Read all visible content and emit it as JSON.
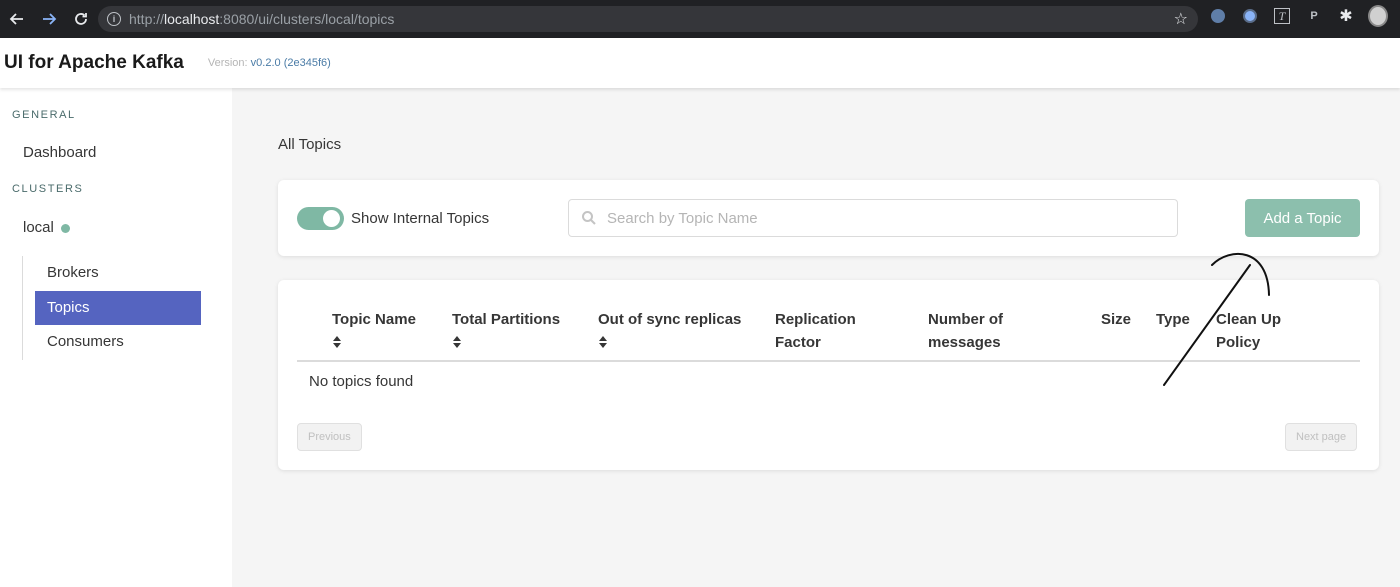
{
  "browser": {
    "url_prefix": "http://",
    "url_host": "localhost",
    "url_rest": ":8080/ui/clusters/local/topics",
    "ext_t": "T",
    "ext_p": "P"
  },
  "header": {
    "title": "UI for Apache Kafka",
    "version_label": "Version:",
    "version_value": "v0.2.0",
    "version_hash": "(2e345f6)"
  },
  "sidebar": {
    "general_label": "GENERAL",
    "dashboard": "Dashboard",
    "clusters_label": "CLUSTERS",
    "cluster_name": "local",
    "items": [
      {
        "label": "Brokers"
      },
      {
        "label": "Topics"
      },
      {
        "label": "Consumers"
      }
    ]
  },
  "main": {
    "page_title": "All Topics",
    "toggle_label": "Show Internal Topics",
    "toggle_on": true,
    "search_placeholder": "Search by Topic Name",
    "add_button": "Add a Topic",
    "columns": [
      {
        "line1": "Topic Name",
        "line2": ""
      },
      {
        "line1": "Total Partitions",
        "line2": ""
      },
      {
        "line1": "Out of sync replicas",
        "line2": ""
      },
      {
        "line1": "Replication",
        "line2": "Factor"
      },
      {
        "line1": "Number of",
        "line2": "messages"
      },
      {
        "line1": "Size",
        "line2": ""
      },
      {
        "line1": "Type",
        "line2": ""
      },
      {
        "line1": "Clean Up",
        "line2": "Policy"
      }
    ],
    "empty_text": "No topics found",
    "previous": "Previous",
    "next": "Next page"
  },
  "colors": {
    "accent_green": "#7fb8a4",
    "active_nav": "#5564c0"
  }
}
